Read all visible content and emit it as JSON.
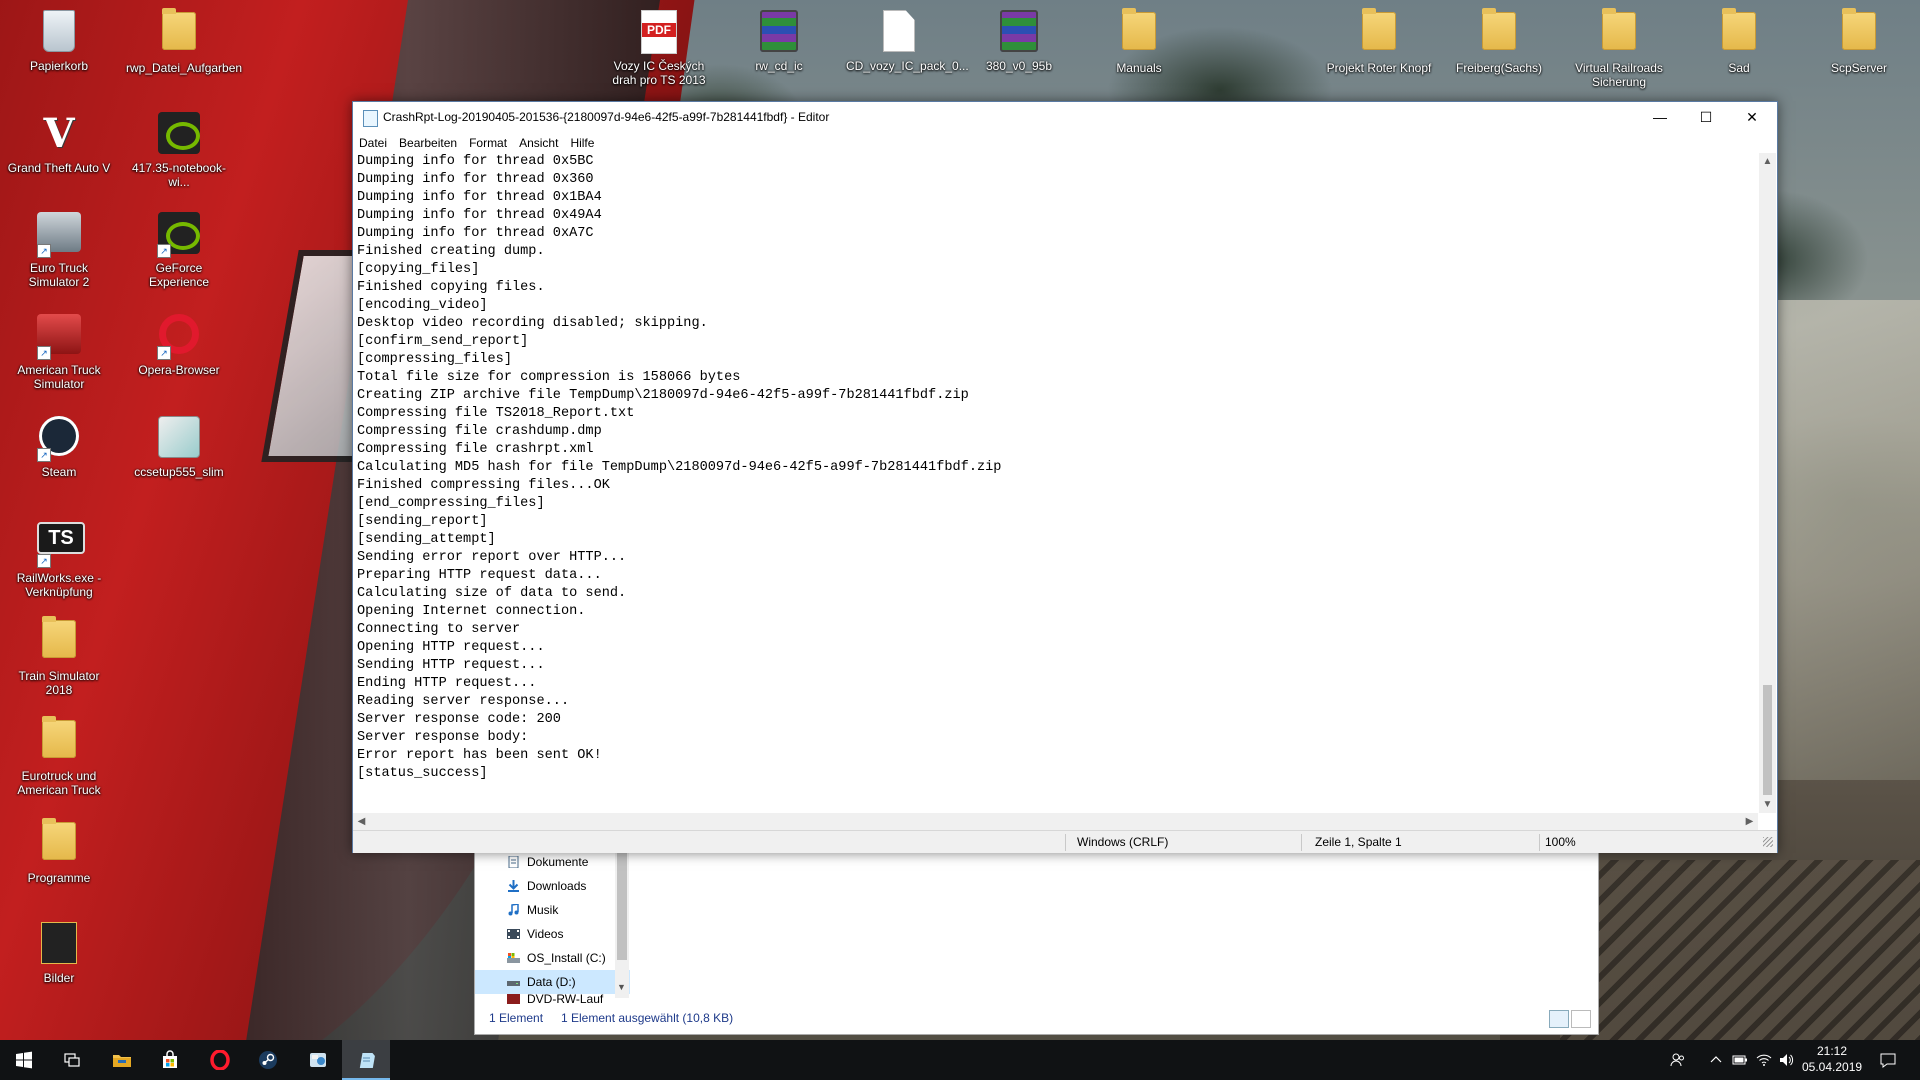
{
  "desktop": {
    "left_column": [
      {
        "label": "Papierkorb",
        "icon": "recycle-bin-icon",
        "shortcut": false
      },
      {
        "label": "Grand Theft Auto V",
        "icon": "gta-icon",
        "shortcut": false
      },
      {
        "label": "Euro Truck Simulator 2",
        "icon": "truck-icon",
        "shortcut": true
      },
      {
        "label": "American Truck Simulator",
        "icon": "truck-red-icon",
        "shortcut": true
      },
      {
        "label": "Steam",
        "icon": "steam-icon",
        "shortcut": true
      },
      {
        "label": "RailWorks.exe - Verknüpfung",
        "icon": "ts-icon",
        "shortcut": true
      },
      {
        "label": "Train Simulator 2018",
        "icon": "folder-icon",
        "shortcut": false
      },
      {
        "label": "Eurotruck und American Truck",
        "icon": "folder-icon",
        "shortcut": false
      },
      {
        "label": "Programme",
        "icon": "folder-icon",
        "shortcut": false
      },
      {
        "label": "Bilder",
        "icon": "folder-dark-icon",
        "shortcut": false
      }
    ],
    "second_column": [
      {
        "label": "rwp_Datei_Aufgarben",
        "icon": "folder-icon",
        "shortcut": false
      },
      {
        "label": "417.35-notebook-wi...",
        "icon": "nvidia-installer-icon",
        "shortcut": false
      },
      {
        "label": "GeForce Experience",
        "icon": "nvidia-icon",
        "shortcut": true
      },
      {
        "label": "Opera-Browser",
        "icon": "opera-icon",
        "shortcut": true
      },
      {
        "label": "ccsetup555_slim",
        "icon": "ccsetup-icon",
        "shortcut": false
      }
    ],
    "top_row": [
      {
        "label": "Vozy IC Českých drah pro TS 2013",
        "icon": "pdf-icon"
      },
      {
        "label": "rw_cd_ic",
        "icon": "rar-icon"
      },
      {
        "label": "CD_vozy_IC_pack_0...",
        "icon": "document-icon"
      },
      {
        "label": "380_v0_95b",
        "icon": "rar-icon"
      },
      {
        "label": "Manuals",
        "icon": "folder-icon"
      },
      {
        "label": "Projekt Roter Knopf",
        "icon": "folder-icon"
      },
      {
        "label": "Freiberg(Sachs)",
        "icon": "folder-icon"
      },
      {
        "label": "Virtual Railroads Sicherung",
        "icon": "folder-icon"
      },
      {
        "label": "Sad",
        "icon": "folder-icon"
      },
      {
        "label": "ScpServer",
        "icon": "folder-icon"
      }
    ]
  },
  "notepad": {
    "title": "CrashRpt-Log-20190405-201536-{2180097d-94e6-42f5-a99f-7b281441fbdf} - Editor",
    "menu": [
      "Datei",
      "Bearbeiten",
      "Format",
      "Ansicht",
      "Hilfe"
    ],
    "controls": {
      "minimize": "—",
      "maximize": "☐",
      "close": "✕"
    },
    "content": "Dumping info for thread 0x5BC\nDumping info for thread 0x360\nDumping info for thread 0x1BA4\nDumping info for thread 0x49A4\nDumping info for thread 0xA7C\nFinished creating dump.\n[copying_files]\nFinished copying files.\n[encoding_video]\nDesktop video recording disabled; skipping.\n[confirm_send_report]\n[compressing_files]\nTotal file size for compression is 158066 bytes\nCreating ZIP archive file TempDump\\2180097d-94e6-42f5-a99f-7b281441fbdf.zip\nCompressing file TS2018_Report.txt\nCompressing file crashdump.dmp\nCompressing file crashrpt.xml\nCalculating MD5 hash for file TempDump\\2180097d-94e6-42f5-a99f-7b281441fbdf.zip\nFinished compressing files...OK\n[end_compressing_files]\n[sending_report]\n[sending_attempt]\nSending error report over HTTP...\nPreparing HTTP request data...\nCalculating size of data to send.\nOpening Internet connection.\nConnecting to server\nOpening HTTP request...\nSending HTTP request...\nEnding HTTP request...\nReading server response...\nServer response code: 200\nServer response body:\nError report has been sent OK!\n[status_success]",
    "status": {
      "line_ending": "Windows (CRLF)",
      "position": "Zeile 1, Spalte 1",
      "zoom": "100%"
    }
  },
  "explorer": {
    "nav": [
      {
        "label": "Dokumente",
        "icon": "documents-icon"
      },
      {
        "label": "Downloads",
        "icon": "downloads-icon"
      },
      {
        "label": "Musik",
        "icon": "music-icon"
      },
      {
        "label": "Videos",
        "icon": "videos-icon"
      },
      {
        "label": "OS_Install (C:)",
        "icon": "drive-c-icon"
      },
      {
        "label": "Data (D:)",
        "icon": "drive-d-icon",
        "selected": true
      },
      {
        "label": "DVD-RW-Lauf",
        "icon": "dvd-icon"
      }
    ],
    "status": {
      "count": "1 Element",
      "selected": "1 Element ausgewählt (10,8 KB)"
    }
  },
  "taskbar": {
    "apps": [
      "start-icon",
      "task-view-icon",
      "file-explorer-icon",
      "store-icon",
      "opera-icon",
      "steam-icon",
      "ccsetup-icon",
      "notepad-icon"
    ],
    "active_index": 7,
    "clock": {
      "time": "21:12",
      "date": "05.04.2019"
    },
    "accent": "#76b9ed"
  }
}
